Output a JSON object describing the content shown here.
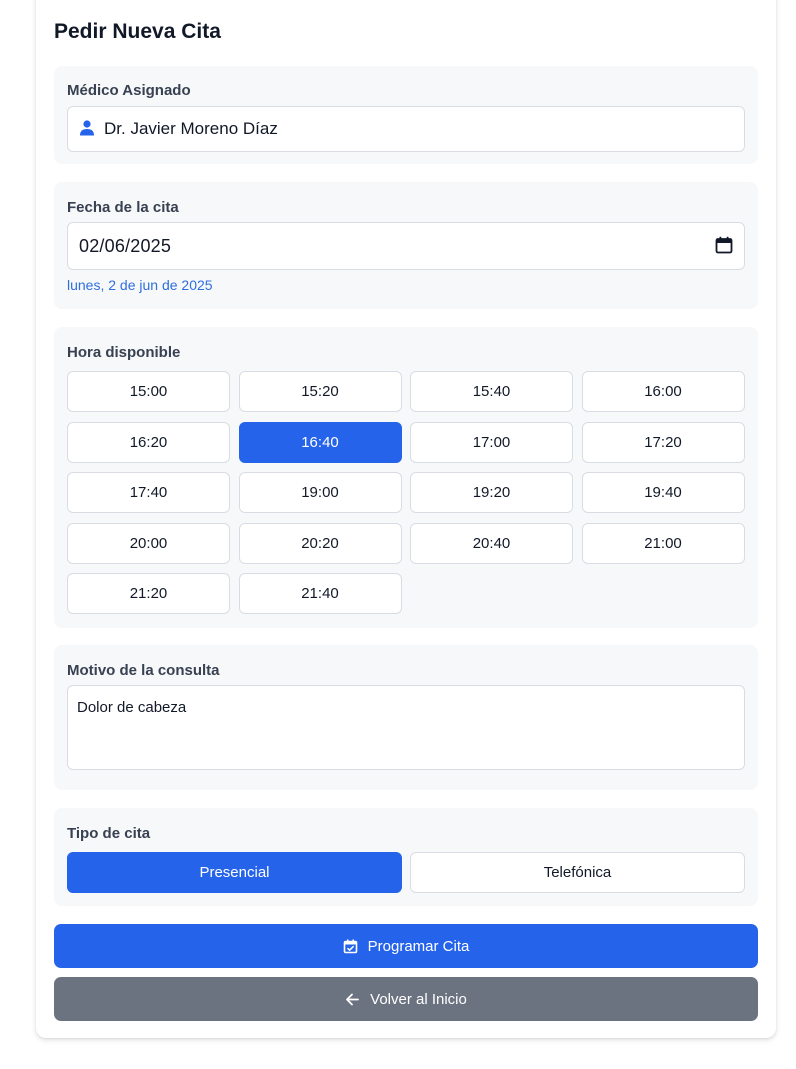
{
  "page": {
    "title": "Pedir Nueva Cita"
  },
  "doctor": {
    "label": "Médico Asignado",
    "name": "Dr. Javier Moreno Díaz",
    "icon": "user-icon"
  },
  "date": {
    "label": "Fecha de la cita",
    "value": "02/06/2025",
    "long": "lunes, 2 de jun de 2025",
    "icon": "calendar-icon"
  },
  "time": {
    "label": "Hora disponible",
    "selected": "16:40",
    "slots": [
      "15:00",
      "15:20",
      "15:40",
      "16:00",
      "16:20",
      "16:40",
      "17:00",
      "17:20",
      "17:40",
      "19:00",
      "19:20",
      "19:40",
      "20:00",
      "20:20",
      "20:40",
      "21:00",
      "21:20",
      "21:40"
    ]
  },
  "reason": {
    "label": "Motivo de la consulta",
    "value": "Dolor de cabeza"
  },
  "type": {
    "label": "Tipo de cita",
    "options": [
      "Presencial",
      "Telefónica"
    ],
    "selected": "Presencial"
  },
  "actions": {
    "submit": {
      "label": "Programar Cita",
      "icon": "calendar-check-icon"
    },
    "back": {
      "label": "Volver al Inicio",
      "icon": "arrow-left-icon"
    }
  },
  "colors": {
    "accent": "#2563eb",
    "secondary": "#6b7280",
    "section_bg": "#f7f8fa",
    "date_text": "#2f6fdd"
  }
}
